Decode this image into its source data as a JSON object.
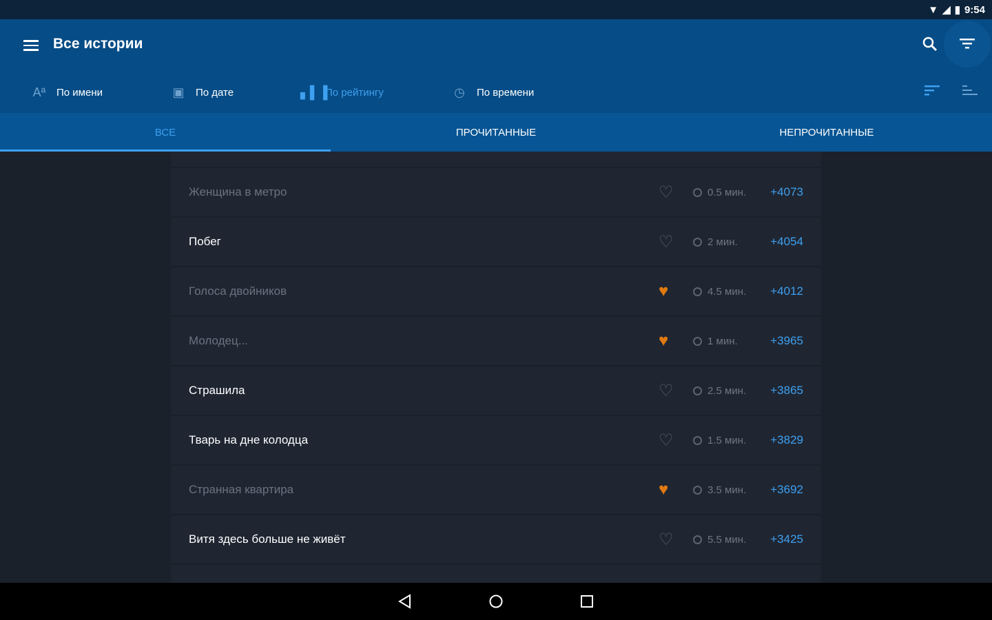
{
  "status": {
    "time": "9:54"
  },
  "header": {
    "title": "Все истории"
  },
  "sort": [
    {
      "label": "По имени",
      "icon": "font-size-icon"
    },
    {
      "label": "По дате",
      "icon": "calendar-icon"
    },
    {
      "label": "По рейтингу",
      "icon": "bar-chart-icon"
    },
    {
      "label": "По времени",
      "icon": "clock-icon"
    }
  ],
  "tabs": [
    {
      "label": "ВСЕ"
    },
    {
      "label": "ПРОЧИТАННЫЕ"
    },
    {
      "label": "НЕПРОЧИТАННЫЕ"
    }
  ],
  "stories": [
    {
      "title": "Женщина в метро",
      "time": "0.5 мин.",
      "score": "+4073",
      "read": true,
      "fav": false
    },
    {
      "title": "Побег",
      "time": "2 мин.",
      "score": "+4054",
      "read": false,
      "fav": false
    },
    {
      "title": "Голоса двойников",
      "time": "4.5 мин.",
      "score": "+4012",
      "read": true,
      "fav": true
    },
    {
      "title": "Молодец...",
      "time": "1 мин.",
      "score": "+3965",
      "read": true,
      "fav": true
    },
    {
      "title": "Страшила",
      "time": "2.5 мин.",
      "score": "+3865",
      "read": false,
      "fav": false
    },
    {
      "title": "Тварь на дне колодца",
      "time": "1.5 мин.",
      "score": "+3829",
      "read": false,
      "fav": false
    },
    {
      "title": "Странная квартира",
      "time": "3.5 мин.",
      "score": "+3692",
      "read": true,
      "fav": true
    },
    {
      "title": "Витя здесь больше не живёт",
      "time": "5.5 мин.",
      "score": "+3425",
      "read": false,
      "fav": false
    }
  ],
  "colors": {
    "accent": "#3ea0f0",
    "appbar": "#064c86",
    "favorite": "#e07a10"
  }
}
